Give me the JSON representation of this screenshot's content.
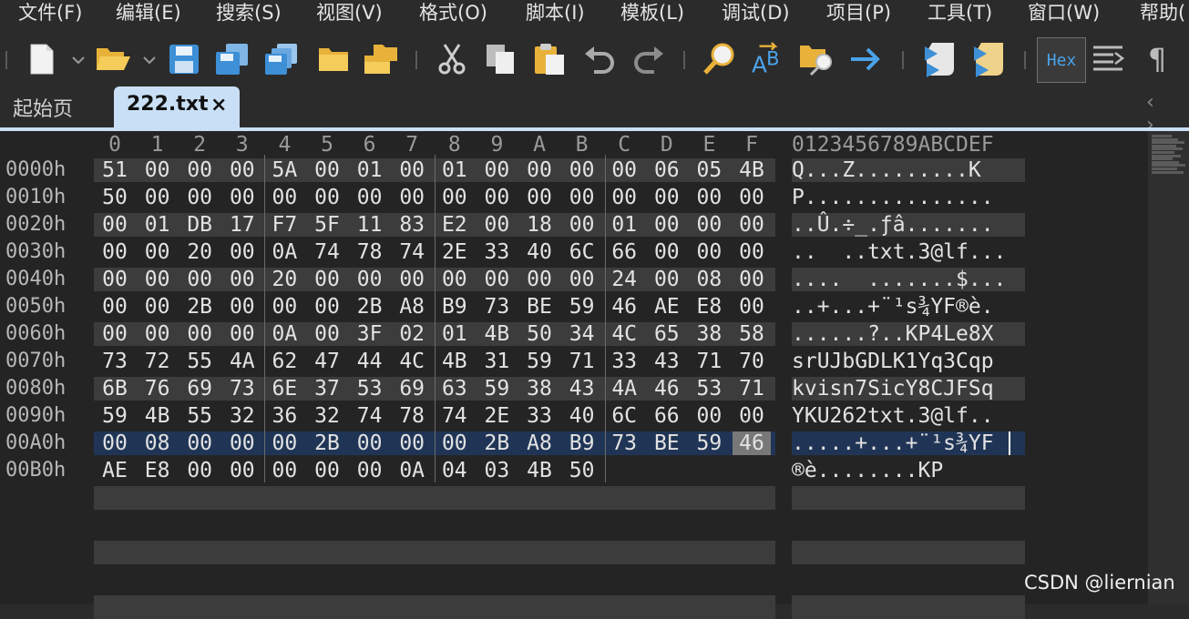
{
  "menu": [
    "文件(F)",
    "编辑(E)",
    "搜索(S)",
    "视图(V)",
    "格式(O)",
    "脚本(I)",
    "模板(L)",
    "调试(D)",
    "项目(P)",
    "工具(T)",
    "窗口(W)",
    "帮助("
  ],
  "toolbar": {
    "icons": [
      "new-file-icon",
      "open-folder-icon",
      "save-icon",
      "save-as-icon",
      "save-all-icon",
      "folder-icon",
      "open-multiple-icon",
      "cut-icon",
      "copy-icon",
      "paste-icon",
      "undo-icon",
      "redo-icon",
      "find-icon",
      "replace-icon",
      "find-in-files-icon",
      "goto-icon",
      "run-script-icon",
      "run-template-icon",
      "hex-mode-icon",
      "format-icon",
      "pilcrow-icon"
    ],
    "hex_label": "Hex",
    "pilcrow": "¶"
  },
  "tabs": {
    "start_label": "起始页",
    "active_label": "222.txt",
    "close_symbol": "×",
    "nav_arrows": "‹ ›"
  },
  "editor": {
    "column_headers": [
      "0",
      "1",
      "2",
      "3",
      "4",
      "5",
      "6",
      "7",
      "8",
      "9",
      "A",
      "B",
      "C",
      "D",
      "E",
      "F"
    ],
    "ascii_header": "0123456789ABCDEF",
    "rows": [
      {
        "addr": "0000h",
        "bytes": [
          "51",
          "00",
          "00",
          "00",
          "5A",
          "00",
          "01",
          "00",
          "01",
          "00",
          "00",
          "00",
          "00",
          "06",
          "05",
          "4B"
        ],
        "ascii": "Q...Z.........K"
      },
      {
        "addr": "0010h",
        "bytes": [
          "50",
          "00",
          "00",
          "00",
          "00",
          "00",
          "00",
          "00",
          "00",
          "00",
          "00",
          "00",
          "00",
          "00",
          "00",
          "00"
        ],
        "ascii": "P..............."
      },
      {
        "addr": "0020h",
        "bytes": [
          "00",
          "01",
          "DB",
          "17",
          "F7",
          "5F",
          "11",
          "83",
          "E2",
          "00",
          "18",
          "00",
          "01",
          "00",
          "00",
          "00"
        ],
        "ascii": "..Û.÷_.ƒâ......."
      },
      {
        "addr": "0030h",
        "bytes": [
          "00",
          "00",
          "20",
          "00",
          "0A",
          "74",
          "78",
          "74",
          "2E",
          "33",
          "40",
          "6C",
          "66",
          "00",
          "00",
          "00"
        ],
        "ascii": "..  ..txt.3@lf..."
      },
      {
        "addr": "0040h",
        "bytes": [
          "00",
          "00",
          "00",
          "00",
          "20",
          "00",
          "00",
          "00",
          "00",
          "00",
          "00",
          "00",
          "24",
          "00",
          "08",
          "00"
        ],
        "ascii": "....  .......$..."
      },
      {
        "addr": "0050h",
        "bytes": [
          "00",
          "00",
          "2B",
          "00",
          "00",
          "00",
          "2B",
          "A8",
          "B9",
          "73",
          "BE",
          "59",
          "46",
          "AE",
          "E8",
          "00"
        ],
        "ascii": "..+...+¨¹s¾YF®è."
      },
      {
        "addr": "0060h",
        "bytes": [
          "00",
          "00",
          "00",
          "00",
          "0A",
          "00",
          "3F",
          "02",
          "01",
          "4B",
          "50",
          "34",
          "4C",
          "65",
          "38",
          "58"
        ],
        "ascii": "......?..KP4Le8X"
      },
      {
        "addr": "0070h",
        "bytes": [
          "73",
          "72",
          "55",
          "4A",
          "62",
          "47",
          "44",
          "4C",
          "4B",
          "31",
          "59",
          "71",
          "33",
          "43",
          "71",
          "70"
        ],
        "ascii": "srUJbGDLK1Yq3Cqp"
      },
      {
        "addr": "0080h",
        "bytes": [
          "6B",
          "76",
          "69",
          "73",
          "6E",
          "37",
          "53",
          "69",
          "63",
          "59",
          "38",
          "43",
          "4A",
          "46",
          "53",
          "71"
        ],
        "ascii": "kvisn7SicY8CJFSq"
      },
      {
        "addr": "0090h",
        "bytes": [
          "59",
          "4B",
          "55",
          "32",
          "36",
          "32",
          "74",
          "78",
          "74",
          "2E",
          "33",
          "40",
          "6C",
          "66",
          "00",
          "00"
        ],
        "ascii": "YKU262txt.3@lf.."
      },
      {
        "addr": "00A0h",
        "bytes": [
          "00",
          "08",
          "00",
          "00",
          "00",
          "2B",
          "00",
          "00",
          "00",
          "2B",
          "A8",
          "B9",
          "73",
          "BE",
          "59",
          "46"
        ],
        "ascii": ".....+...+¨¹s¾YF"
      },
      {
        "addr": "00B0h",
        "bytes": [
          "AE",
          "E8",
          "00",
          "00",
          "00",
          "00",
          "00",
          "0A",
          "04",
          "03",
          "4B",
          "50",
          "",
          "",
          "",
          ""
        ],
        "ascii": "®è........KP"
      }
    ],
    "selected_row_index": 10,
    "cursor_byte_index": 15
  },
  "colors": {
    "background": "#242424",
    "band": "#3c3c3c",
    "selection": "#203556",
    "active_tab": "#c9dff5"
  },
  "watermark": "CSDN @liernian"
}
